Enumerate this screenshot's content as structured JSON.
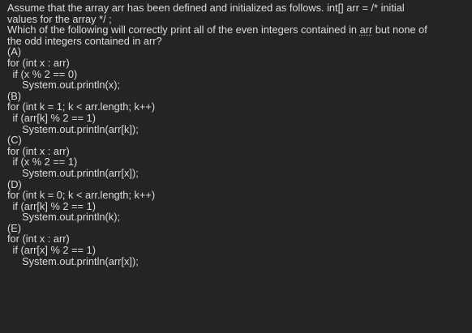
{
  "question": {
    "line1": "Assume that the array arr has been defined and initialized as follows. int[] arr = /* initial",
    "line2": "values for the array */ ;",
    "line3_pre": "Which of the following will correctly print all of the even integers contained in ",
    "line3_word": "arr",
    "line3_post": " but none of",
    "line4": "the odd integers contained in arr?"
  },
  "options": [
    {
      "label": "(A)",
      "lines": [
        "for (int x : arr)",
        " if (x % 2 == 0)",
        "  System.out.println(x);"
      ]
    },
    {
      "label": "(B)",
      "lines": [
        "for (int k = 1; k < arr.length; k++)",
        " if (arr[k] % 2 == 1)",
        "  System.out.println(arr[k]);"
      ]
    },
    {
      "label": "(C)",
      "lines": [
        "for (int x : arr)",
        " if (x % 2 == 1)",
        "  System.out.println(arr[x]);"
      ]
    },
    {
      "label": "(D)",
      "lines": [
        "for (int k = 0; k < arr.length; k++)",
        " if (arr[k] % 2 == 1)",
        "  System.out.println(k);"
      ]
    },
    {
      "label": "(E)",
      "lines": [
        "for (int x : arr)",
        " if (arr[x] % 2 == 1)",
        "  System.out.println(arr[x]);"
      ]
    }
  ]
}
